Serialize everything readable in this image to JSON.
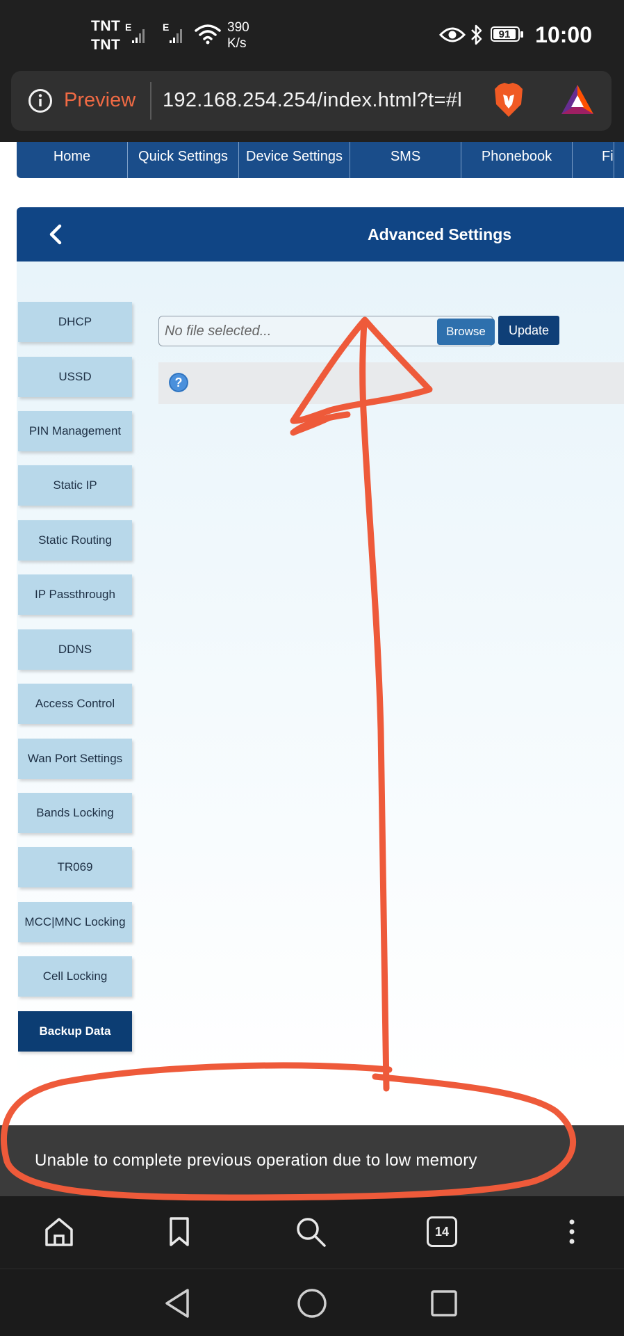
{
  "status_bar": {
    "carrier_1": "TNT",
    "carrier_2": "TNT",
    "network_1": "E",
    "network_2": "E",
    "speed_value": "390",
    "speed_unit": "K/s",
    "battery": "91",
    "time": "10:00"
  },
  "browser": {
    "preview_label": "Preview",
    "url": "192.168.254.254/index.html?t=#l",
    "tab_count": "14"
  },
  "nav": {
    "items": [
      "Home",
      "Quick Settings",
      "Device Settings",
      "SMS",
      "Phonebook",
      "Fire"
    ]
  },
  "header": {
    "title": "Advanced Settings"
  },
  "sidebar": {
    "items": [
      "DHCP",
      "USSD",
      "PIN Management",
      "Static IP",
      "Static Routing",
      "IP Passthrough",
      "DDNS",
      "Access Control",
      "Wan Port Settings",
      "Bands Locking",
      "TR069",
      "MCC|MNC Locking",
      "Cell Locking",
      "Backup Data"
    ],
    "active": "Backup Data"
  },
  "upload": {
    "placeholder": "No file selected...",
    "browse_label": "Browse",
    "update_label": "Update"
  },
  "toast": {
    "message": "Unable to complete previous operation due to low memory"
  },
  "colors": {
    "annotation": "#ee5a3a",
    "nav_blue": "#104585",
    "sidebar_item": "#b8d8ea"
  }
}
